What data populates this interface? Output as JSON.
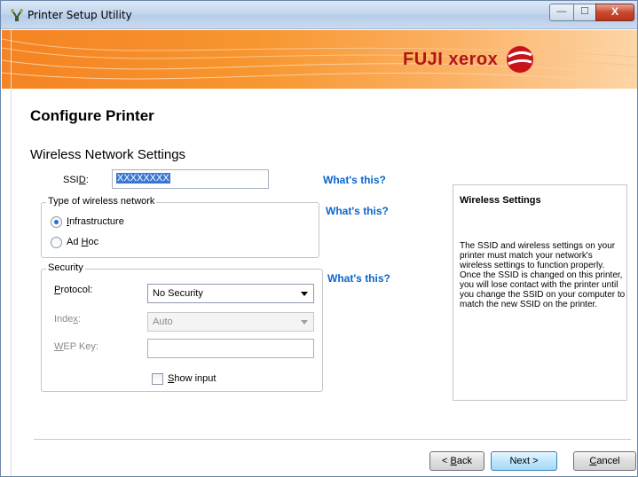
{
  "window": {
    "title": "Printer Setup Utility"
  },
  "window_controls": {
    "minimize": "—",
    "maximize": "☐",
    "close": "X"
  },
  "banner": {
    "brand": "FUJI xerox"
  },
  "page": {
    "title": "Configure Printer",
    "section_title": "Wireless Network Settings"
  },
  "ssid": {
    "label": "SSID:",
    "value": "XXXXXXXX",
    "whats_this": "What's this?"
  },
  "wireless_type": {
    "legend": "Type of wireless network",
    "options": [
      {
        "label": "Infrastructure",
        "selected": true
      },
      {
        "label": "Ad Hoc",
        "selected": false
      }
    ],
    "whats_this": "What's this?"
  },
  "security": {
    "legend": "Security",
    "protocol_label": "Protocol:",
    "protocol_value": "No Security",
    "index_label": "Index:",
    "index_value": "Auto",
    "wep_key_label": "WEP Key:",
    "wep_key_value": "",
    "show_input_label": "Show input",
    "whats_this": "What's this?"
  },
  "info_panel": {
    "title": "Wireless Settings",
    "body": "The SSID and wireless settings on your printer must match your network's wireless settings to function properly. Once the SSID is changed on this printer, you will lose contact with the printer until you change the SSID on your computer to match the new SSID on the printer."
  },
  "buttons": {
    "back": "< Back",
    "next": "Next >",
    "cancel": "Cancel"
  },
  "colors": {
    "banner_orange": "#f58322",
    "brand_red": "#b0151a",
    "link_blue": "#0b66cc"
  }
}
